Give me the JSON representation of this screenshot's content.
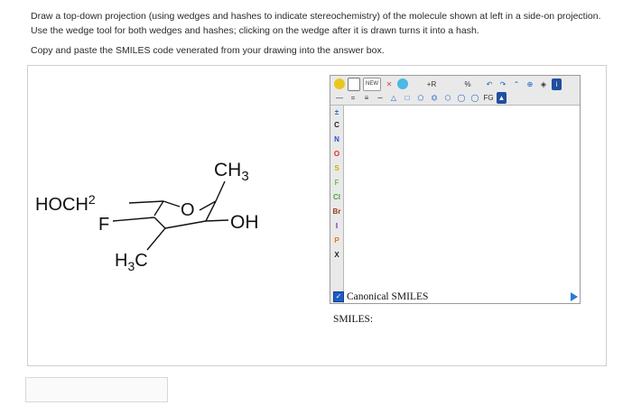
{
  "instructions": {
    "line1": "Draw a top-down projection (using wedges and hashes to indicate stereochemistry) of the molecule shown at left in a side-on projection. Use the wedge tool for both wedges and hashes; clicking on the wedge after it is drawn turns it into a hash.",
    "line2": "Copy and paste the SMILES code venerated from your drawing into the answer box."
  },
  "molecule": {
    "labels": {
      "ch3": "CH",
      "ch3_sub": "3",
      "hoch2": "HOCH",
      "hoch2_sub": "2",
      "f": "F",
      "o": "O",
      "oh": "OH",
      "h3c": "H",
      "h3c_sub": "3",
      "h3c_tail": "C"
    }
  },
  "editor": {
    "toolbar_top": {
      "new_label": "NEW",
      "rf_label": "+R",
      "percent_label": "%",
      "fg_label": "FG",
      "info_label": "i"
    },
    "atoms": [
      "C",
      "N",
      "O",
      "S",
      "F",
      "Cl",
      "Br",
      "I",
      "P",
      "X"
    ],
    "colors": {
      "C": "#222222",
      "N": "#2a4fd0",
      "O": "#e03020",
      "S": "#c8b400",
      "F": "#6cc04a",
      "Cl": "#4aa23a",
      "Br": "#9a3a1a",
      "I": "#7a2aa0",
      "P": "#e07a10",
      "X": "#222222"
    }
  },
  "canonical_smiles": {
    "label": "Canonical SMILES",
    "checked": true
  },
  "smiles_label": "SMILES:",
  "answer_box": {
    "value": ""
  }
}
